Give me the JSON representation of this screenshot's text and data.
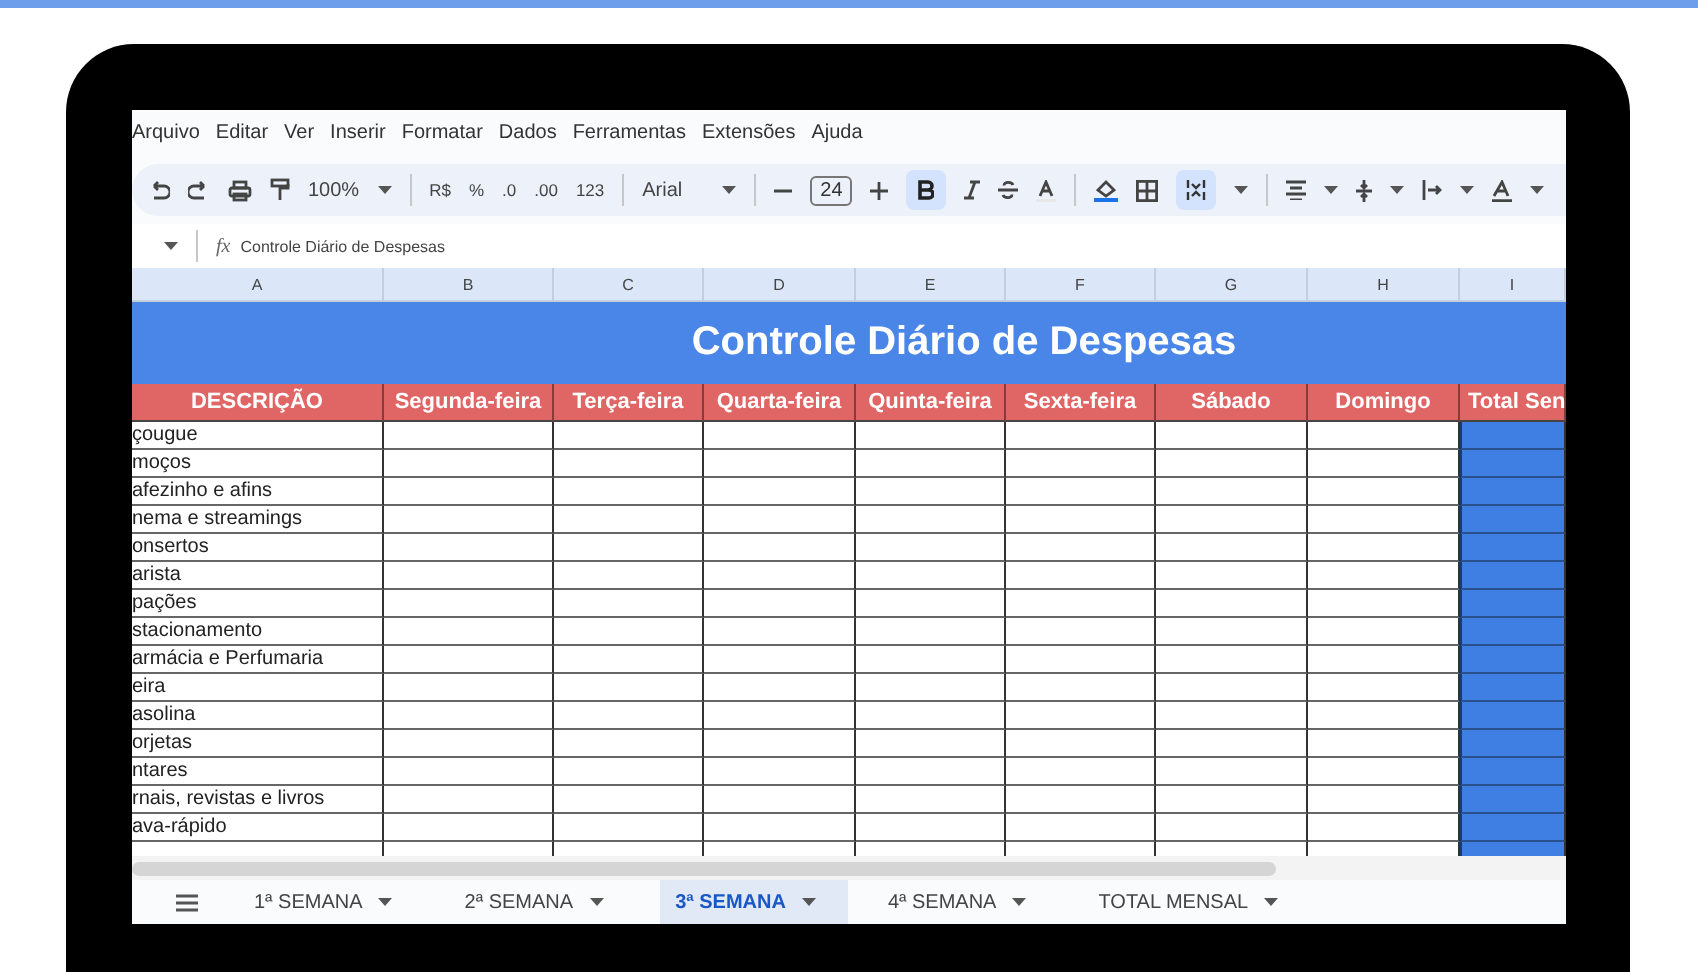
{
  "menu": [
    "Arquivo",
    "Editar",
    "Ver",
    "Inserir",
    "Formatar",
    "Dados",
    "Ferramentas",
    "Extensões",
    "Ajuda"
  ],
  "toolbar": {
    "zoom": "100%",
    "currency": "R$",
    "percent": "%",
    "decrease_decimals": ".0",
    "increase_decimals": ".00",
    "number_format": "123",
    "font": "Arial",
    "font_size": "24",
    "bold_on": true,
    "merge_on": true
  },
  "formula_bar": {
    "fx": "fx",
    "content": "Controle Diário de Despesas"
  },
  "columns": [
    "A",
    "B",
    "C",
    "D",
    "E",
    "F",
    "G",
    "H",
    "I"
  ],
  "title": "Controle Diário de Despesas",
  "header": [
    "DESCRIÇÃO",
    "Segunda-feira",
    "Terça-feira",
    "Quarta-feira",
    "Quinta-feira",
    "Sexta-feira",
    "Sábado",
    "Domingo",
    "Total Sen"
  ],
  "rows": [
    "çougue",
    "moços",
    "afezinho e afins",
    "nema e streamings",
    "onsertos",
    "arista",
    "pações",
    "stacionamento",
    "armácia e Perfumaria",
    "eira",
    "asolina",
    "orjetas",
    "ntares",
    "rnais, revistas e livros",
    "ava-rápido"
  ],
  "sheet_tabs": [
    {
      "label": "1ª SEMANA",
      "selected": false
    },
    {
      "label": "2ª SEMANA",
      "selected": false
    },
    {
      "label": "3ª SEMANA",
      "selected": true
    },
    {
      "label": "4ª SEMANA",
      "selected": false
    },
    {
      "label": "TOTAL MENSAL",
      "selected": false
    }
  ]
}
